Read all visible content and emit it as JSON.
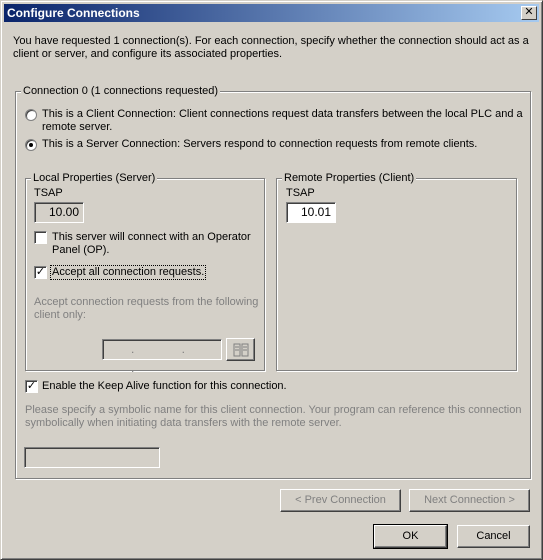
{
  "window": {
    "title": "Configure Connections",
    "close_glyph": "✕"
  },
  "intro_text_line1": "You have requested 1 connection(s).  For each connection, specify whether the connection should act as a",
  "intro_text_line2": "client or server, and configure its associated properties.",
  "connection_group": {
    "title": "Connection 0 (1 connections requested)",
    "client_option_line1": "This is a Client Connection: Client connections request data transfers between the local PLC and a",
    "client_option_line2": "remote server.",
    "client_selected": false,
    "server_option": "This is a Server Connection: Servers respond to connection requests from remote clients.",
    "server_selected": true
  },
  "local_group": {
    "title": "Local Properties (Server)",
    "tsap_label": "TSAP",
    "tsap_value": "10.00",
    "operator_panel_line1": "This server will connect with an Operator",
    "operator_panel_line2": "Panel (OP).",
    "operator_panel_checked": false,
    "accept_all_label": "Accept all connection requests.",
    "accept_all_checked": true,
    "accept_from_line1": "Accept connection requests from the following",
    "accept_from_line2": "client only:",
    "ip_dots": ". . ."
  },
  "remote_group": {
    "title": "Remote Properties (Client)",
    "tsap_label": "TSAP",
    "tsap_value": "10.01"
  },
  "keep_alive": {
    "label": "Enable the Keep Alive function for this connection.",
    "checked": true
  },
  "symbolic_text_line1": "Please specify a symbolic name for this client connection.  Your program can reference this connection",
  "symbolic_text_line2": "symbolically when initiating data transfers with the remote server.",
  "symbolic_name_value": "",
  "buttons": {
    "prev": "< Prev Connection",
    "next": "Next Connection >",
    "ok": "OK",
    "cancel": "Cancel"
  },
  "icons": {
    "close": "close-icon",
    "address_book": "address-book-icon"
  }
}
